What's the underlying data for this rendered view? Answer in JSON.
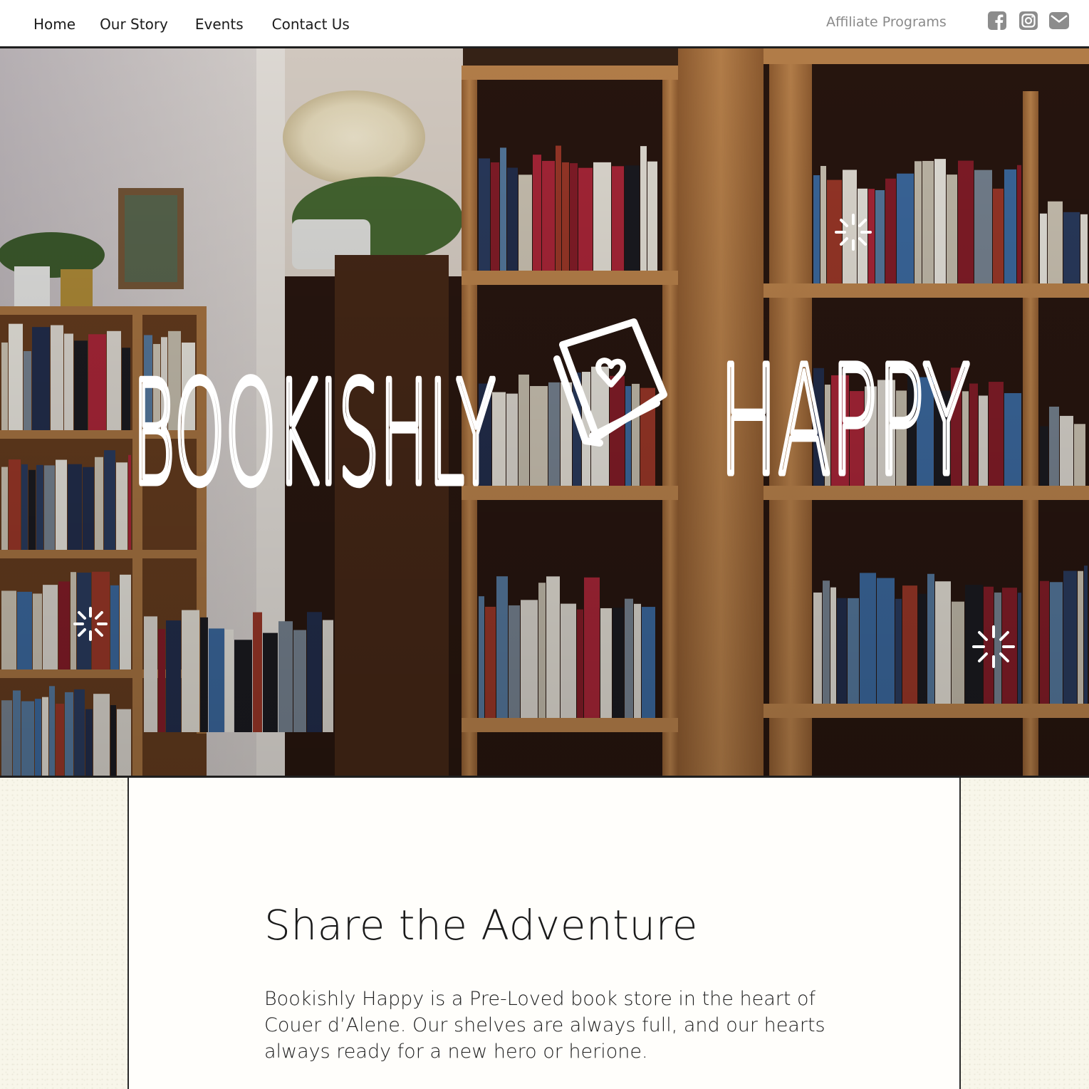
{
  "nav": {
    "items": [
      {
        "label": "Home",
        "name": "nav-home"
      },
      {
        "label": "Our Story",
        "name": "nav-our-story"
      },
      {
        "label": "Events",
        "name": "nav-events"
      },
      {
        "label": "Contact Us",
        "name": "nav-contact-us"
      }
    ],
    "affiliate": "Affiliate Programs",
    "social": [
      "facebook-icon",
      "instagram-icon",
      "email-icon"
    ]
  },
  "hero": {
    "logo_word_1": "BOOKISHLY",
    "logo_word_2": "HAPPY",
    "logo_icon": "book-heart-icon",
    "sparkle_icon": "sparkle-icon"
  },
  "main": {
    "heading": "Share the Adventure",
    "body": "Bookishly Happy is a Pre-Loved book store in the heart of Couer d’Alene. Our shelves are always full, and our hearts always ready for a new hero or herione."
  },
  "colors": {
    "nav_text": "#1c1c1c",
    "affiliate_text": "#8a8a8a",
    "icon_gray": "#8c8c8c",
    "background": "#f8f6ea",
    "wood": "#b07a45"
  }
}
